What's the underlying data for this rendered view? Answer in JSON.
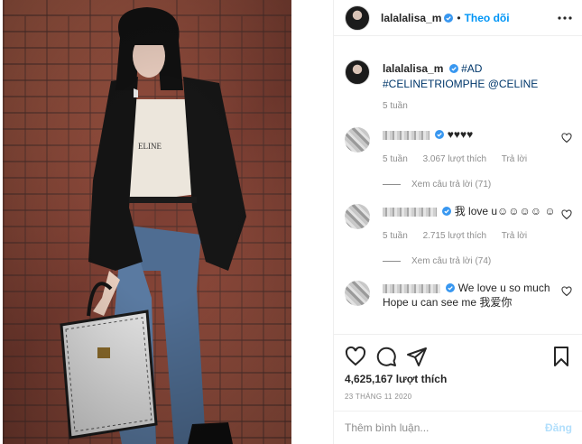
{
  "post": {
    "username": "lalalalisa_m",
    "follow_label": "Theo dõi",
    "dot": "•",
    "caption_hashtags": "#AD #CELINETRIOMPHE",
    "caption_mention": "@CELINE",
    "caption_time": "5 tuần",
    "likes": "4,625,167 lượt thích",
    "date": "23 THÁNG 11 2020"
  },
  "comments": [
    {
      "text": "♥♥♥♥",
      "time": "5 tuần",
      "likes": "3.067 lượt thích",
      "reply": "Trả lời",
      "view_replies": "Xem câu trả lời (71)"
    },
    {
      "text": "我 love u☺☺☺☺ ☺",
      "time": "5 tuần",
      "likes": "2.715 lượt thích",
      "reply": "Trả lời",
      "view_replies": "Xem câu trả lời (74)"
    },
    {
      "text": "We love u so much Hope u can see me 我爱你",
      "time": "",
      "likes": "",
      "reply": "",
      "view_replies": ""
    }
  ],
  "add_comment": {
    "placeholder": "Thêm bình luận...",
    "post_label": "Đăng"
  },
  "icons": [
    "more-icon",
    "verified-icon",
    "heart-icon",
    "comment-icon",
    "share-icon",
    "bookmark-icon"
  ],
  "colors": {
    "link": "#0095f6",
    "tag": "#00376b",
    "muted": "#8e8e8e",
    "post_disabled": "#b2dffc"
  }
}
